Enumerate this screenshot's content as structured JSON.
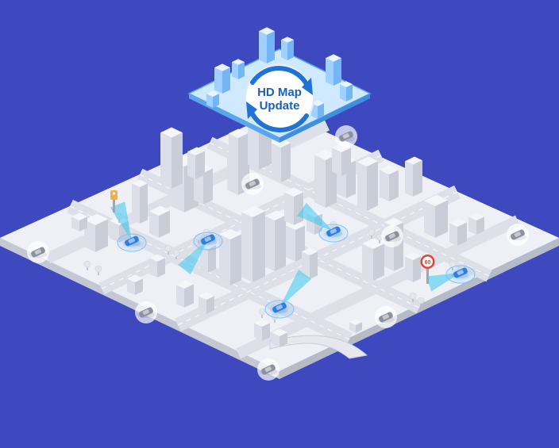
{
  "badge": {
    "line1": "HD Map",
    "line2": "Update"
  },
  "sign": {
    "text": "60"
  },
  "colors": {
    "background": "#3f49bf",
    "ground": "#eef0f5",
    "road": "#dfe2ea",
    "building_top": "#f5f6f9",
    "building_left": "#dcdfe7",
    "building_right": "#c9cdd8",
    "highlight_blue": "#2f7fe0",
    "beam_cyan": "#38c8f0",
    "sign_red": "#e0453a"
  },
  "icons": {
    "update_cycle": "circular-arrows-icon",
    "vehicle": "car-icon",
    "speed_sign": "speed-limit-sign-icon",
    "traffic_light": "traffic-light-icon"
  }
}
